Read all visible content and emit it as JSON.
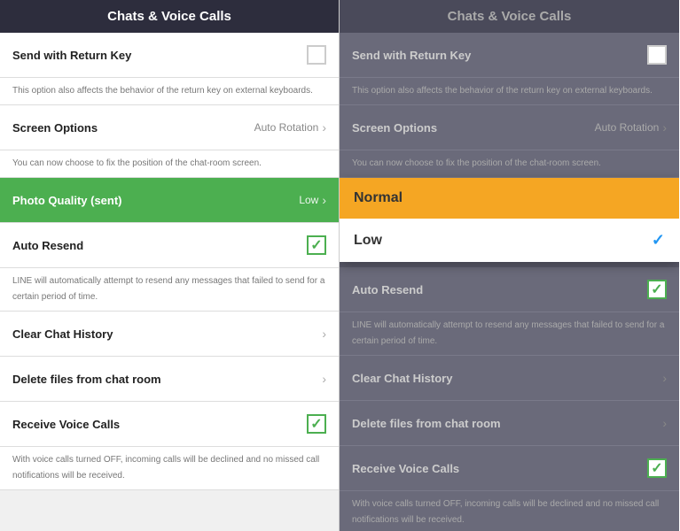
{
  "left_panel": {
    "header": "Chats & Voice Calls",
    "items": [
      {
        "id": "send-return-key",
        "title": "Send with Return Key",
        "description": "",
        "type": "checkbox",
        "checked": false
      },
      {
        "id": "send-return-key-desc",
        "description": "This option also affects the behavior of the return key on external keyboards.",
        "type": "description-only"
      },
      {
        "id": "screen-options",
        "title": "Screen Options",
        "value": "Auto Rotation",
        "type": "navigation"
      },
      {
        "id": "screen-options-desc",
        "description": "You can now choose to fix the position of the chat-room screen.",
        "type": "description-only"
      },
      {
        "id": "photo-quality",
        "title": "Photo Quality (sent)",
        "value": "Low",
        "type": "navigation-green"
      },
      {
        "id": "auto-resend",
        "title": "Auto Resend",
        "type": "checkbox",
        "checked": true
      },
      {
        "id": "auto-resend-desc",
        "description": "LINE will automatically attempt to resend any messages that failed to send for a certain period of time.",
        "type": "description-only"
      },
      {
        "id": "clear-chat-history",
        "title": "Clear Chat History",
        "type": "navigation"
      },
      {
        "id": "delete-files",
        "title": "Delete files from chat room",
        "type": "navigation"
      },
      {
        "id": "receive-voice-calls",
        "title": "Receive Voice Calls",
        "type": "checkbox",
        "checked": true
      },
      {
        "id": "receive-voice-calls-desc",
        "description": "With voice calls turned OFF, incoming calls will be declined and no missed call notifications will be received.",
        "type": "description-only"
      }
    ]
  },
  "right_panel": {
    "header": "Chats & Voice Calls",
    "dropdown": {
      "options": [
        {
          "id": "normal",
          "label": "Normal",
          "selected": false
        },
        {
          "id": "low",
          "label": "Low",
          "selected": true
        }
      ]
    },
    "items": [
      {
        "id": "send-return-key",
        "title": "Send with Return Key",
        "description": "",
        "type": "checkbox",
        "checked": false
      },
      {
        "id": "send-return-key-desc",
        "description": "This option also affects the behavior of the return key on external keyboards.",
        "type": "description-only"
      },
      {
        "id": "screen-options",
        "title": "Screen Options",
        "value": "Auto Rotation",
        "type": "navigation"
      },
      {
        "id": "screen-options-desc",
        "description": "You can now choose to fix the position of the chat-room screen.",
        "type": "description-only"
      },
      {
        "id": "photo-quality",
        "title": "Photo Quality (sent)",
        "value": "Low",
        "type": "navigation-dropdown"
      },
      {
        "id": "auto-resend",
        "title": "Auto Resend",
        "type": "checkbox",
        "checked": true
      },
      {
        "id": "auto-resend-desc",
        "description": "LINE will automatically attempt to resend any messages that failed to send for a certain period of time.",
        "type": "description-only"
      },
      {
        "id": "clear-chat-history",
        "title": "Clear Chat History",
        "type": "navigation"
      },
      {
        "id": "delete-files",
        "title": "Delete files from chat room",
        "type": "navigation"
      },
      {
        "id": "receive-voice-calls",
        "title": "Receive Voice Calls",
        "type": "checkbox",
        "checked": true
      },
      {
        "id": "receive-voice-calls-desc",
        "description": "With voice calls turned OFF, incoming calls will be declined and no missed call notifications will be received.",
        "type": "description-only"
      }
    ]
  }
}
